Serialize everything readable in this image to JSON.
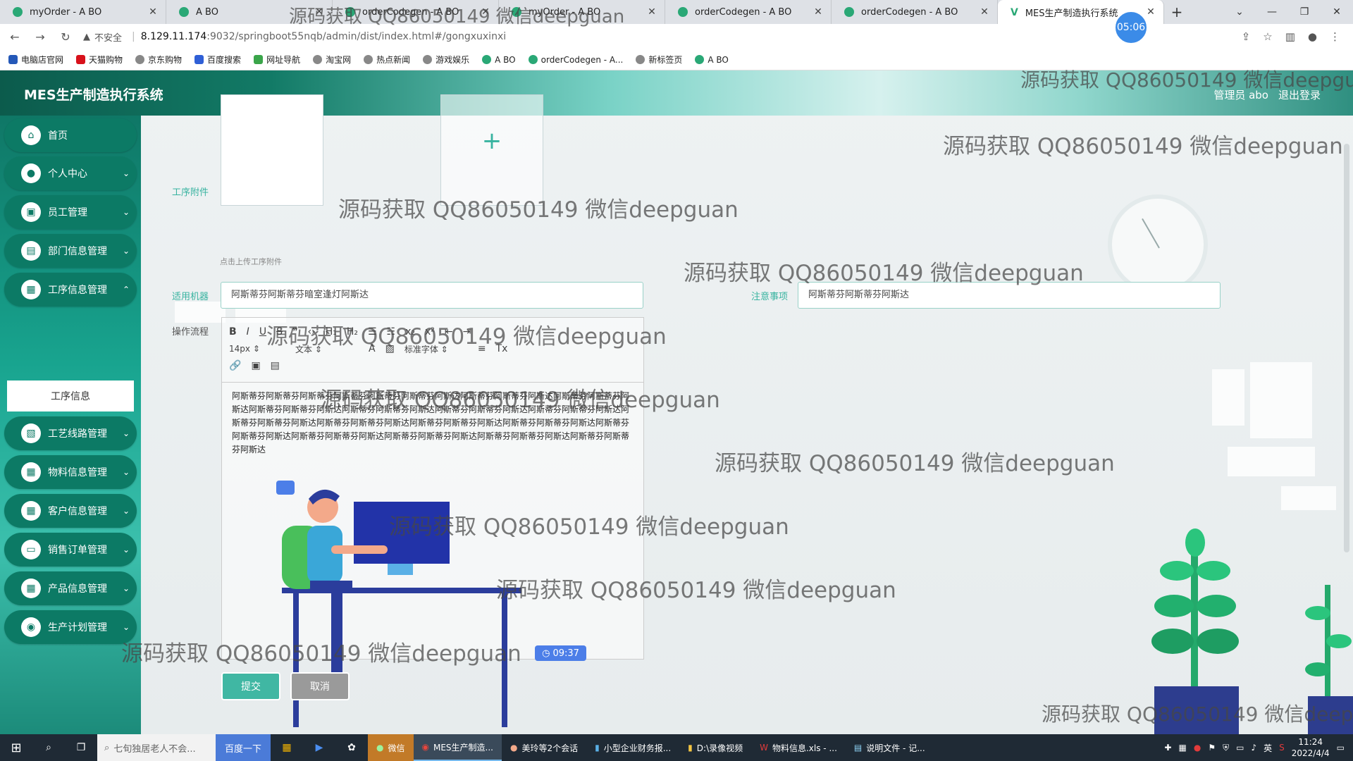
{
  "browser": {
    "tabs": [
      {
        "title": "myOrder - A BO",
        "active": false
      },
      {
        "title": "A BO",
        "active": false
      },
      {
        "title": "orderCodegen - A BO",
        "active": false
      },
      {
        "title": "myOrder - A BO",
        "active": false
      },
      {
        "title": "orderCodegen - A BO",
        "active": false
      },
      {
        "title": "orderCodegen - A BO",
        "active": false
      },
      {
        "title": "MES生产制造执行系统",
        "active": true
      }
    ],
    "new_tab": "+",
    "record_timer": "05:06",
    "security_label": "不安全",
    "url_host": "8.129.11.174",
    "url_path": ":9032/springboot55nqb/admin/dist/index.html#/gongxuxinxi",
    "bookmarks": [
      "电脑店官网",
      "天猫购物",
      "京东购物",
      "百度搜索",
      "网址导航",
      "淘宝网",
      "热点新闻",
      "游戏娱乐",
      "A BO",
      "orderCodegen - A...",
      "新标签页",
      "A BO"
    ]
  },
  "app": {
    "title": "MES生产制造执行系统",
    "user": "管理员 abo",
    "logout": "退出登录"
  },
  "sidebar": {
    "items": [
      {
        "label": "首页",
        "icon": "home-icon",
        "expandable": false
      },
      {
        "label": "个人中心",
        "icon": "user-icon",
        "expandable": true
      },
      {
        "label": "员工管理",
        "icon": "badge-icon",
        "expandable": true
      },
      {
        "label": "部门信息管理",
        "icon": "briefcase-icon",
        "expandable": true
      },
      {
        "label": "工序信息管理",
        "icon": "grid-icon",
        "expandable": true
      },
      {
        "label": "工艺线路管理",
        "icon": "clipboard-icon",
        "expandable": true
      },
      {
        "label": "物料信息管理",
        "icon": "grid-icon",
        "expandable": true
      },
      {
        "label": "客户信息管理",
        "icon": "grid-icon",
        "expandable": true
      },
      {
        "label": "销售订单管理",
        "icon": "monitor-icon",
        "expandable": true
      },
      {
        "label": "产品信息管理",
        "icon": "grid-icon",
        "expandable": true
      },
      {
        "label": "生产计划管理",
        "icon": "pin-icon",
        "expandable": true
      }
    ],
    "submenu_active": "工序信息"
  },
  "form": {
    "attachment_label": "工序附件",
    "attachment_hint": "点击上传工序附件",
    "machine_label": "适用机器",
    "machine_value": "阿斯蒂芬阿斯蒂芬暗室逢灯阿斯达",
    "notes_label": "注意事项",
    "notes_value": "阿斯蒂芬阿斯蒂芬阿斯达",
    "process_label": "操作流程",
    "editor": {
      "font_size": "14px",
      "text_type": "文本",
      "font_family": "标准字体",
      "content": "阿斯蒂芬阿斯蒂芬阿斯蒂芬阿斯蒂芬阿斯蒂芬阿斯蒂芬阿斯达阿斯蒂芬阿斯蒂芬阿斯达阿斯蒂芬阿斯蒂芬阿斯达阿斯蒂芬阿斯蒂芬阿斯达阿斯蒂芬阿斯蒂芬阿斯达阿斯蒂芬阿斯蒂芬阿斯达阿斯蒂芬阿斯蒂芬阿斯达阿斯蒂芬阿斯蒂芬阿斯达阿斯蒂芬阿斯蒂芬阿斯达阿斯蒂芬阿斯蒂芬阿斯达阿斯蒂芬阿斯蒂芬阿斯达阿斯蒂芬阿斯蒂芬阿斯达阿斯蒂芬阿斯蒂芬阿斯达阿斯蒂芬阿斯蒂芬阿斯达阿斯蒂芬阿斯蒂芬阿斯达阿斯蒂芬阿斯蒂芬阿斯达"
    },
    "submit": "提交",
    "cancel": "取消"
  },
  "illustration_time": "09:37",
  "watermark": "源码获取 QQ86050149 微信deepguan",
  "taskbar": {
    "search_placeholder": "七旬独居老人不会...",
    "search_button": "百度一下",
    "apps": [
      "微信",
      "MES生产制造...",
      "美玲等2个会话",
      "小型企业财务报...",
      "D:\\录像视频",
      "物料信息.xls - ...",
      "说明文件 - 记..."
    ],
    "time": "11:24",
    "date": "2022/4/4",
    "ime": "英"
  },
  "colors": {
    "accent": "#38b3a0",
    "sidebar_item": "#0c7a65",
    "submit": "#40b7a3",
    "cancel": "#9a9a9a"
  }
}
